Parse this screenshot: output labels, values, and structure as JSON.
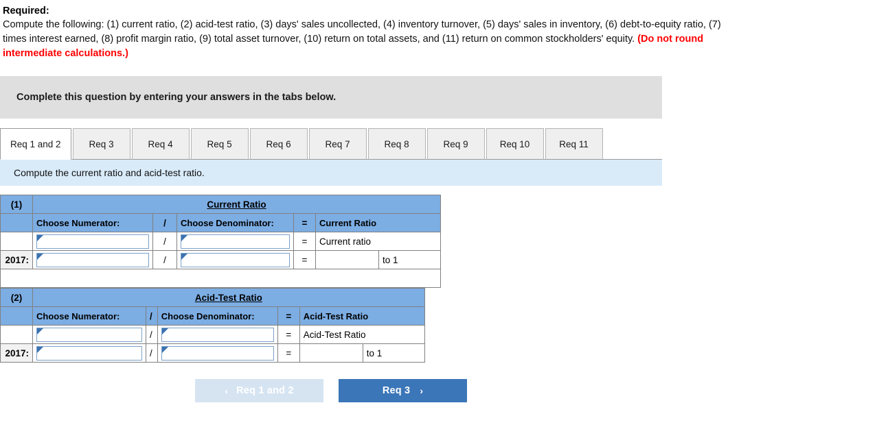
{
  "required": {
    "title": "Required:",
    "body_prefix": "Compute the following: (1) current ratio, (2) acid-test ratio, (3) days' sales uncollected, (4) inventory turnover, (5) days' sales in inventory, (6) debt-to-equity ratio, (7) times interest earned, (8) profit margin ratio, (9) total asset turnover, (10) return on total assets, and (11) return on common stockholders' equity.",
    "red_note": "(Do not round intermediate calculations.)"
  },
  "banner": {
    "text": "Complete this question by entering your answers in the tabs below."
  },
  "tabs": [
    {
      "label": "Req 1 and 2",
      "active": true
    },
    {
      "label": "Req 3",
      "active": false
    },
    {
      "label": "Req 4",
      "active": false
    },
    {
      "label": "Req 5",
      "active": false
    },
    {
      "label": "Req 6",
      "active": false
    },
    {
      "label": "Req 7",
      "active": false
    },
    {
      "label": "Req 8",
      "active": false
    },
    {
      "label": "Req 9",
      "active": false
    },
    {
      "label": "Req 10",
      "active": false
    },
    {
      "label": "Req 11",
      "active": false
    }
  ],
  "instruction": {
    "text": "Compute the current ratio and acid-test ratio."
  },
  "table1": {
    "index": "(1)",
    "title": "Current Ratio",
    "col_numerator": "Choose Numerator:",
    "col_slash": "/",
    "col_denominator": "Choose Denominator:",
    "col_equals": "=",
    "col_result": "Current Ratio",
    "row1_equals": "=",
    "row1_result_label": "Current ratio",
    "row2_year": "2017:",
    "row2_slash": "/",
    "row2_equals": "=",
    "row2_answer": "",
    "row2_suffix": "to 1",
    "row1_numerator_value": "",
    "row1_denominator_value": "",
    "row2_numerator_value": "",
    "row2_denominator_value": ""
  },
  "table2": {
    "index": "(2)",
    "title": "Acid-Test Ratio",
    "col_numerator": "Choose Numerator:",
    "col_slash": "/",
    "col_denominator": "Choose Denominator:",
    "col_equals": "=",
    "col_result": "Acid-Test Ratio",
    "row1_equals": "=",
    "row1_result_label": "Acid-Test Ratio",
    "row2_year": "2017:",
    "row2_slash": "/",
    "row2_equals": "=",
    "row2_answer": "",
    "row2_suffix": "to 1",
    "row1_numerator_value": "",
    "row1_denominator_value": "",
    "row2_numerator_value": "",
    "row2_denominator_value": ""
  },
  "nav": {
    "prev_label": "Req 1 and 2",
    "prev_chevron": "‹",
    "next_label": "Req 3",
    "next_chevron": "›"
  },
  "colors": {
    "header_blue": "#7CADE3",
    "instruction_blue": "#D9EBF9",
    "banner_gray": "#DFDFDF",
    "button_blue": "#3B76B8",
    "button_disabled": "#D6E4F2",
    "red": "#FF0000"
  }
}
